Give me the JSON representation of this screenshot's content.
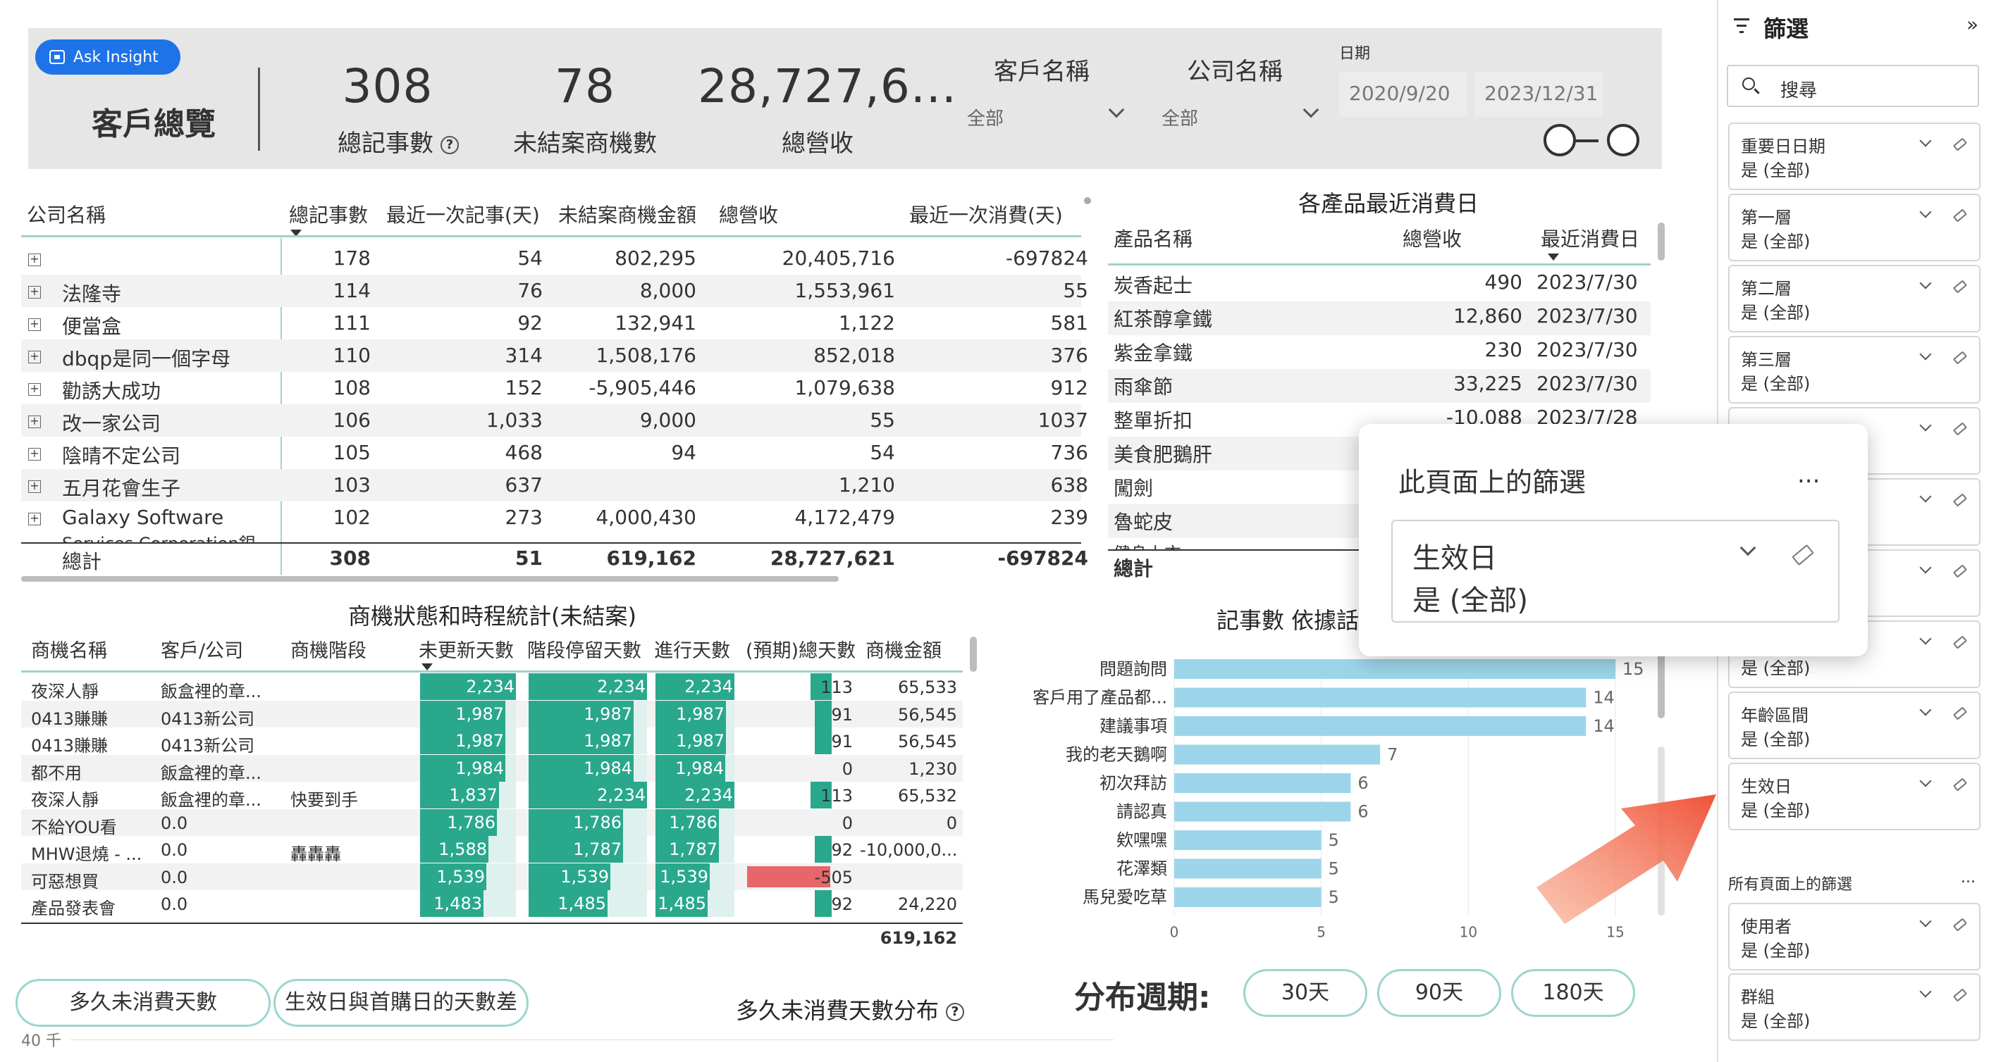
{
  "header": {
    "ask_insight": "Ask Insight",
    "page_title": "客戶總覽",
    "kpis": [
      {
        "value": "308",
        "label": "總記事數"
      },
      {
        "value": "78",
        "label": "未結案商機數"
      },
      {
        "value": "28,727,6...",
        "label": "總營收"
      }
    ],
    "customer_slicer": {
      "title": "客戶名稱",
      "value": "全部"
    },
    "company_slicer": {
      "title": "公司名稱",
      "value": "全部"
    },
    "date_slicer": {
      "title": "日期",
      "start": "2020/9/20",
      "end": "2023/12/31"
    }
  },
  "company_table": {
    "columns": [
      "公司名稱",
      "總記事數",
      "最近一次記事(天)",
      "未結案商機金額",
      "總營收",
      "最近一次消費(天)"
    ],
    "rows": [
      [
        "",
        "178",
        "54",
        "802,295",
        "20,405,716",
        "-697824"
      ],
      [
        "法隆寺",
        "114",
        "76",
        "8,000",
        "1,553,961",
        "55"
      ],
      [
        "便當盒",
        "111",
        "92",
        "132,941",
        "1,122",
        "581"
      ],
      [
        "dbqp是同一個字母",
        "110",
        "314",
        "1,508,176",
        "852,018",
        "376"
      ],
      [
        "勸誘大成功",
        "108",
        "152",
        "-5,905,446",
        "1,079,638",
        "912"
      ],
      [
        "改一家公司",
        "106",
        "1,033",
        "9,000",
        "55",
        "1037"
      ],
      [
        "陰晴不定公司",
        "105",
        "468",
        "94",
        "54",
        "736"
      ],
      [
        "五月花會生子",
        "103",
        "637",
        "",
        "1,210",
        "638"
      ],
      [
        "Galaxy Software",
        "102",
        "273",
        "4,000,430",
        "4,172,479",
        "239"
      ]
    ],
    "partial_row": "Services Corporation銀",
    "total": [
      "總計",
      "308",
      "51",
      "619,162",
      "28,727,621",
      "-697824"
    ]
  },
  "product_table": {
    "title": "各產品最近消費日",
    "columns": [
      "產品名稱",
      "總營收",
      "最近消費日"
    ],
    "rows": [
      [
        "炭香起士",
        "490",
        "2023/7/30"
      ],
      [
        "紅茶醇拿鐵",
        "12,860",
        "2023/7/30"
      ],
      [
        "紫金拿鐵",
        "230",
        "2023/7/30"
      ],
      [
        "雨傘節",
        "33,225",
        "2023/7/30"
      ],
      [
        "整單折扣",
        "-10,088",
        "2023/7/28"
      ],
      [
        "美食肥鵝肝",
        "",
        ""
      ],
      [
        "闖劍",
        "",
        ""
      ],
      [
        "魯蛇皮",
        "",
        ""
      ]
    ],
    "partial_row": "健身上衣",
    "total_label": "總計"
  },
  "opportunity_table": {
    "title": "商機狀態和時程統計(未結案)",
    "columns": [
      "商機名稱",
      "客戶/公司",
      "商機階段",
      "未更新天數",
      "階段停留天數",
      "進行天數",
      "(預期)總天數",
      "商機金額"
    ],
    "rows": [
      [
        "夜深人靜",
        "飯盒裡的章...",
        "",
        "2,234",
        "2,234",
        "2,234",
        "113",
        "65,533"
      ],
      [
        "0413賺賺",
        "0413新公司",
        "",
        "1,987",
        "1,987",
        "1,987",
        "91",
        "56,545"
      ],
      [
        "0413賺賺",
        "0413新公司",
        "",
        "1,987",
        "1,987",
        "1,987",
        "91",
        "56,545"
      ],
      [
        "都不用",
        "飯盒裡的章...",
        "",
        "1,984",
        "1,984",
        "1,984",
        "0",
        "1,230"
      ],
      [
        "夜深人靜",
        "飯盒裡的章...",
        "快要到手",
        "1,837",
        "2,234",
        "2,234",
        "113",
        "65,532"
      ],
      [
        "不給YOU看",
        "0.0",
        "",
        "1,786",
        "1,786",
        "1,786",
        "0",
        "0"
      ],
      [
        "MHW退燒 - ...",
        "0.0",
        "轟轟轟",
        "1,588",
        "1,787",
        "1,787",
        "92",
        "-10,000,0..."
      ],
      [
        "可惡想買",
        "0.0",
        "",
        "1,539",
        "1,539",
        "1,539",
        "-505",
        ""
      ],
      [
        "產品發表會",
        "0.0",
        "",
        "1,483",
        "1,485",
        "1,485",
        "92",
        "24,220"
      ]
    ],
    "total_amount": "619,162"
  },
  "bar_chart": {
    "title": "記事數 依據話",
    "ticks": [
      "0",
      "5",
      "10",
      "15"
    ]
  },
  "chart_data": {
    "type": "bar",
    "categories": [
      "問題詢問",
      "客戶用了產品都...",
      "建議事項",
      "我的老天鵝啊",
      "初次拜訪",
      "請認真",
      "欸嘿嘿",
      "花澤類",
      "馬兒愛吃草"
    ],
    "values": [
      15,
      14,
      14,
      7,
      6,
      6,
      5,
      5,
      5
    ],
    "xlim": [
      0,
      15
    ]
  },
  "bottom": {
    "tab_idle": "多久未消費天數",
    "tab_diff": "生效日與首購日的天數差",
    "dist_title": "多久未消費天數分布",
    "axis_partial": "40 千",
    "period_label": "分布週期:",
    "period_options": [
      "30天",
      "90天",
      "180天"
    ]
  },
  "popup": {
    "title": "此頁面上的篩選",
    "more": "...",
    "filter_name": "生效日",
    "filter_value": "是 (全部)"
  },
  "filter_pane": {
    "title": "篩選",
    "search_placeholder": "搜尋",
    "collapse": "»",
    "page_filters": [
      {
        "name": "重要日日期",
        "value": "是 (全部)"
      },
      {
        "name": "第一層",
        "value": "是 (全部)"
      },
      {
        "name": "第二層",
        "value": "是 (全部)"
      },
      {
        "name": "第三層",
        "value": "是 (全部)"
      },
      {
        "name": "",
        "value": ""
      },
      {
        "name": "",
        "value": ""
      },
      {
        "name": "",
        "value": ""
      },
      {
        "name": "",
        "value": "是 (全部)"
      },
      {
        "name": "年齡區間",
        "value": "是 (全部)"
      },
      {
        "name": "生效日",
        "value": "是 (全部)"
      }
    ],
    "all_pages_title": "所有頁面上的篩選",
    "all_pages_more": "...",
    "all_filters": [
      {
        "name": "使用者",
        "value": "是 (全部)"
      },
      {
        "name": "群組",
        "value": "是 (全部)"
      }
    ]
  },
  "colors": {
    "accent": "#1e73e8",
    "teal": "#2aa88c",
    "bar": "#9cd5ea",
    "negative": "#e8666a",
    "arrow": "#f26a50"
  }
}
